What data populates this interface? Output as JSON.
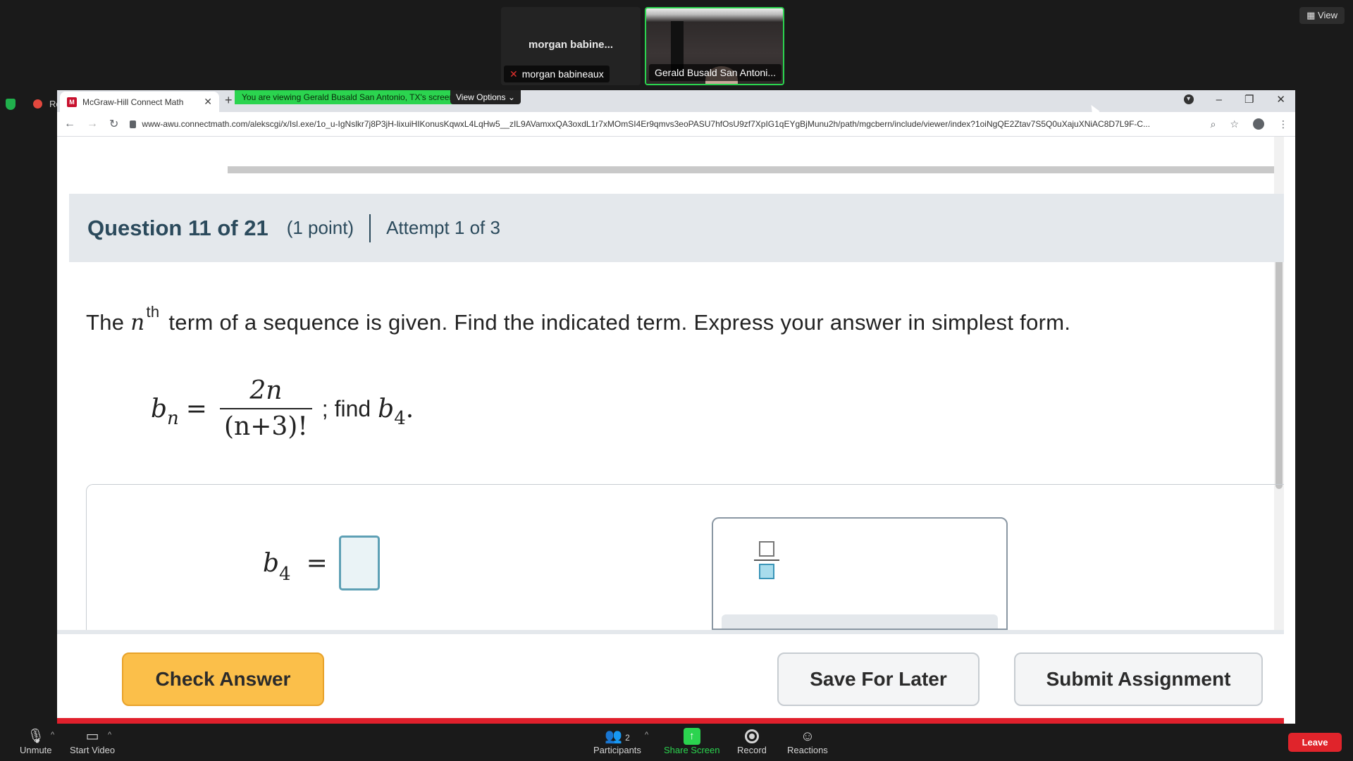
{
  "zoom": {
    "participant_tile_1": {
      "center_name": "morgan babine...",
      "label": "morgan babineaux"
    },
    "participant_tile_2": {
      "label": "Gerald Busald San Antoni..."
    },
    "view_button": "View",
    "edge_label": "Re",
    "share_banner": "You are viewing Gerald Busald San Antonio, TX's screen",
    "view_options": "View Options",
    "toolbar": {
      "unmute": "Unmute",
      "start_video": "Start Video",
      "participants": "Participants",
      "participants_count": "2",
      "share_screen": "Share Screen",
      "record": "Record",
      "reactions": "Reactions",
      "leave": "Leave"
    },
    "colors": {
      "active_speaker": "#2bd44f",
      "leave": "#e0242b"
    }
  },
  "browser": {
    "tab_title": "McGraw-Hill Connect Math",
    "url": "www-awu.connectmath.com/alekscgi/x/Isl.exe/1o_u-IgNslkr7j8P3jH-lixuiHIKonusKqwxL4LqHw5__zIL9AVamxxQA3oxdL1r7xMOmSI4Er9qmvs3eoPASU7hfOsU9zf7XpIG1qEYgBjMunu2h/path/mgcbern/include/viewer/index?1oiNgQE2Ztav7S5Q0uXajuXNiAC8D7L9F-C..."
  },
  "question": {
    "title": "Question 11 of 21",
    "points": "(1 point)",
    "attempt": "Attempt 1 of 3",
    "prompt_pre": "The",
    "prompt_var": "n",
    "prompt_sup": "th",
    "prompt_post": "term of a sequence is given. Find the indicated term. Express your answer in simplest form.",
    "formula": {
      "lhs_base": "b",
      "lhs_sub": "n",
      "equals": "=",
      "numerator": "2n",
      "denominator": "(n+3)!",
      "find_text": "; find",
      "target_base": "b",
      "target_sub": "4",
      "period": "."
    },
    "answer": {
      "lhs_base": "b",
      "lhs_sub": "4",
      "equals": "=",
      "value": ""
    }
  },
  "buttons": {
    "check": "Check Answer",
    "save": "Save For Later",
    "submit": "Submit Assignment"
  }
}
